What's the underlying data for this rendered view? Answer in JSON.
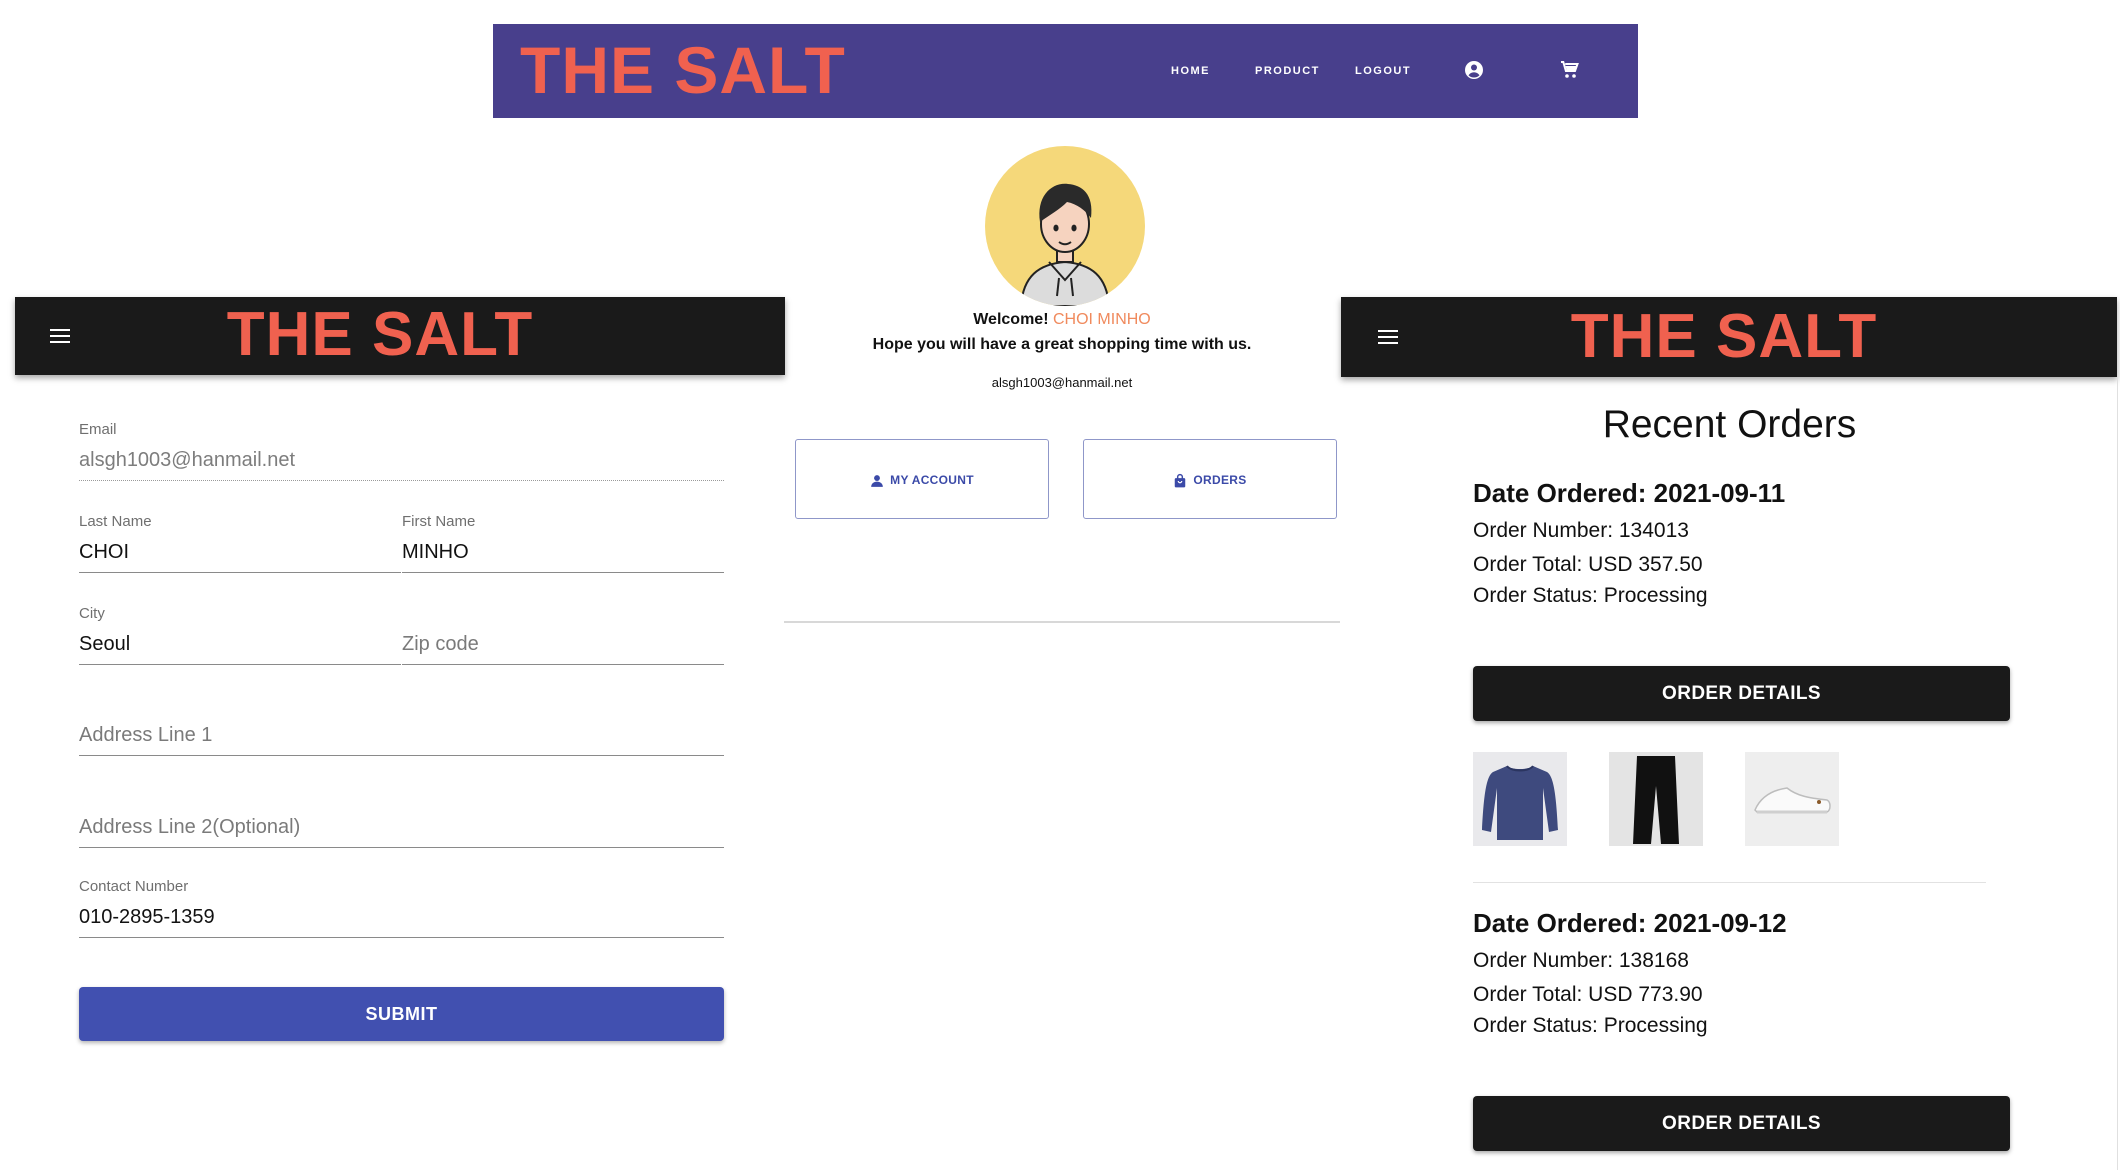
{
  "top_nav": {
    "brand": "THE SALT",
    "links": [
      "HOME",
      "PRODUCT",
      "LOGOUT"
    ],
    "icons": [
      "account-circle-icon",
      "cart-icon"
    ]
  },
  "left_panel": {
    "brand": "THE SALT",
    "email": {
      "label": "Email",
      "value": "alsgh1003@hanmail.net"
    },
    "last_name": {
      "label": "Last Name",
      "value": "CHOI"
    },
    "first_name": {
      "label": "First Name",
      "value": "MINHO"
    },
    "city": {
      "label": "City",
      "value": "Seoul"
    },
    "zip": {
      "placeholder": "Zip code"
    },
    "address1": {
      "placeholder": "Address Line 1"
    },
    "address2": {
      "placeholder": "Address Line 2(Optional)"
    },
    "contact": {
      "label": "Contact Number",
      "value": "010-2895-1359"
    },
    "submit_label": "SUBMIT"
  },
  "center_panel": {
    "welcome_prefix": "Welcome!",
    "user_name": "CHOI MINHO",
    "tagline": "Hope you will have a great shopping time with us.",
    "email": "alsgh1003@hanmail.net",
    "my_account_label": "MY ACCOUNT",
    "orders_label": "ORDERS"
  },
  "right_panel": {
    "brand": "THE SALT",
    "heading": "Recent Orders",
    "orders": [
      {
        "date_line": "Date Ordered: 2021-09-11",
        "number_line": "Order Number: 134013",
        "total_line": "Order Total: USD 357.50",
        "status_line": "Order Status: Processing",
        "button_label": "ORDER DETAILS",
        "items": [
          "navy-sweater",
          "black-pants",
          "white-sneakers"
        ]
      },
      {
        "date_line": "Date Ordered: 2021-09-12",
        "number_line": "Order Number: 138168",
        "total_line": "Order Total: USD 773.90",
        "status_line": "Order Status: Processing",
        "button_label": "ORDER DETAILS"
      }
    ]
  },
  "colors": {
    "brand_red": "#f0614f",
    "nav_purple": "#483f8c",
    "submit_blue": "#4150b0",
    "header_dark": "#1a1a1a",
    "name_accent": "#f08a5d",
    "avatar_bg": "#f5d87a"
  }
}
